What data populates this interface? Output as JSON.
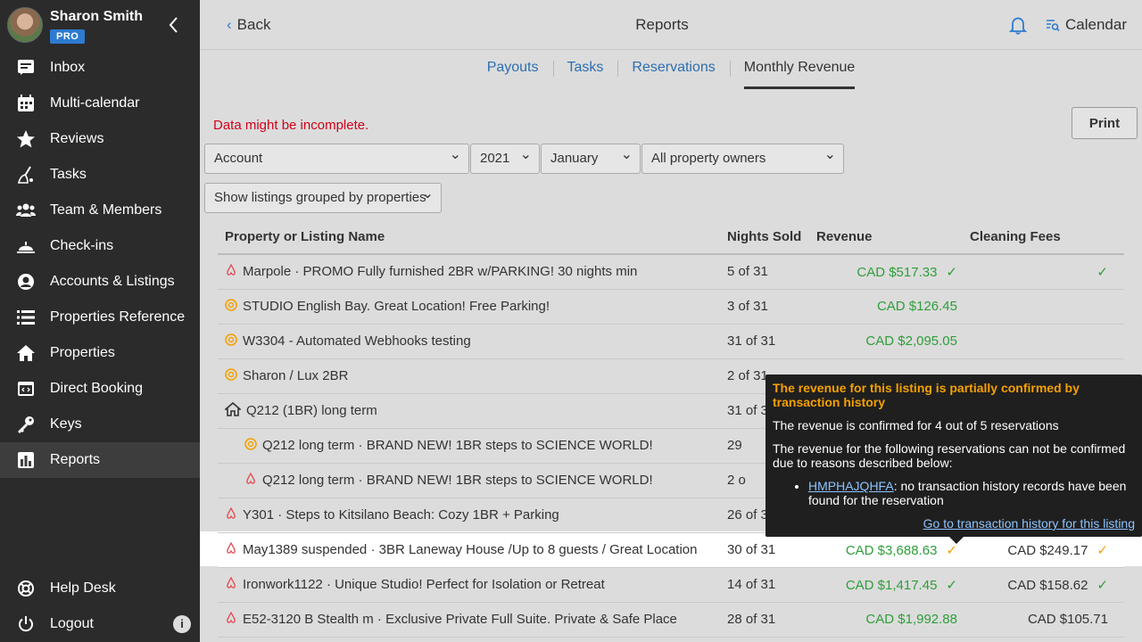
{
  "user": {
    "name": "Sharon Smith",
    "badge": "PRO"
  },
  "nav": [
    {
      "label": "Inbox",
      "icon": "inbox-icon"
    },
    {
      "label": "Multi-calendar",
      "icon": "calendar-icon"
    },
    {
      "label": "Reviews",
      "icon": "star-icon"
    },
    {
      "label": "Tasks",
      "icon": "broom-icon"
    },
    {
      "label": "Team & Members",
      "icon": "team-icon"
    },
    {
      "label": "Check-ins",
      "icon": "bell-desk-icon"
    },
    {
      "label": "Accounts & Listings",
      "icon": "user-circle-icon"
    },
    {
      "label": "Properties Reference",
      "icon": "list-icon"
    },
    {
      "label": "Properties",
      "icon": "home-icon"
    },
    {
      "label": "Direct Booking",
      "icon": "browser-code-icon"
    },
    {
      "label": "Keys",
      "icon": "key-icon"
    },
    {
      "label": "Reports",
      "icon": "chart-icon",
      "active": true
    }
  ],
  "nav_bottom": [
    {
      "label": "Help Desk",
      "icon": "lifebuoy-icon"
    },
    {
      "label": "Logout",
      "icon": "power-icon"
    }
  ],
  "header": {
    "back": "Back",
    "title": "Reports",
    "calendar": "Calendar"
  },
  "tabs": [
    "Payouts",
    "Tasks",
    "Reservations",
    "Monthly Revenue"
  ],
  "active_tab": "Monthly Revenue",
  "warning": "Data might be incomplete.",
  "print": "Print",
  "filters": {
    "account": "Account",
    "year": "2021",
    "month": "January",
    "owners": "All property owners",
    "grouping": "Show listings grouped by properties"
  },
  "table": {
    "headers": [
      "Property or Listing Name",
      "Nights Sold",
      "Revenue",
      "Cleaning Fees"
    ],
    "rows": [
      {
        "icon": "airbnb",
        "name": "Marpole · PROMO Fully furnished 2BR w/PARKING! 30 nights min",
        "nights": "5 of 31",
        "revenue": "CAD $517.33",
        "rev_check": "green",
        "cleaning": "",
        "clean_check": "green"
      },
      {
        "icon": "booking",
        "name": "STUDIO English Bay. Great Location! Free Parking!",
        "nights": "3 of 31",
        "revenue": "CAD $126.45",
        "cleaning": ""
      },
      {
        "icon": "booking",
        "name": "W3304 - Automated Webhooks testing",
        "nights": "31 of 31",
        "revenue": "CAD $2,095.05",
        "cleaning": ""
      },
      {
        "icon": "booking",
        "name": "Sharon / Lux 2BR",
        "nights": "2 of 31",
        "revenue": "",
        "cleaning": ""
      },
      {
        "icon": "home",
        "name": "Q212 (1BR) long term",
        "nights": "31 of 3",
        "revenue": "",
        "cleaning": ""
      },
      {
        "icon": "booking",
        "indent": true,
        "name": "Q212 long term · BRAND NEW! 1BR steps to SCIENCE WORLD!",
        "nights": "29",
        "revenue": "",
        "cleaning": ""
      },
      {
        "icon": "airbnb",
        "indent": true,
        "name": "Q212 long term · BRAND NEW! 1BR steps to SCIENCE WORLD!",
        "nights": "2 o",
        "revenue": "",
        "cleaning": ""
      },
      {
        "icon": "airbnb",
        "name": "Y301 · Steps to Kitsilano Beach: Cozy 1BR + Parking",
        "nights": "26 of 3",
        "revenue": "",
        "cleaning": ""
      },
      {
        "icon": "airbnb",
        "name": "May1389 suspended · 3BR Laneway House /Up to 8 guests / Great Location",
        "nights": "30 of 31",
        "revenue": "CAD $3,688.63",
        "rev_check": "orange",
        "cleaning": "CAD $249.17",
        "clean_check": "orange",
        "highlight": true
      },
      {
        "icon": "airbnb",
        "name": "Ironwork1122 · Unique Studio! Perfect for Isolation or Retreat",
        "nights": "14 of 31",
        "revenue": "CAD $1,417.45",
        "rev_check": "green",
        "cleaning": "CAD $158.62",
        "clean_check": "green"
      },
      {
        "icon": "airbnb",
        "name": "E52-3120 B Stealth m · Exclusive Private Full Suite. Private & Safe Place",
        "nights": "28 of 31",
        "revenue": "CAD $1,992.88",
        "cleaning": "CAD $105.71"
      }
    ]
  },
  "tooltip": {
    "title": "The revenue for this listing is partially confirmed by transaction history",
    "confirmed": "The revenue is confirmed for 4 out of 5 reservations",
    "reasons": "The revenue for the following reservations can not be confirmed due to reasons described below:",
    "item_code": "HMPHAJQHFA",
    "item_text": ": no transaction history records have been found for the reservation",
    "link": "Go to transaction history for this listing"
  },
  "colors": {
    "sidebar": "#2b2b2b",
    "accent": "#2d7bd1",
    "success": "#2e9e3a",
    "warning": "#f5a000",
    "error": "#d0021b"
  }
}
